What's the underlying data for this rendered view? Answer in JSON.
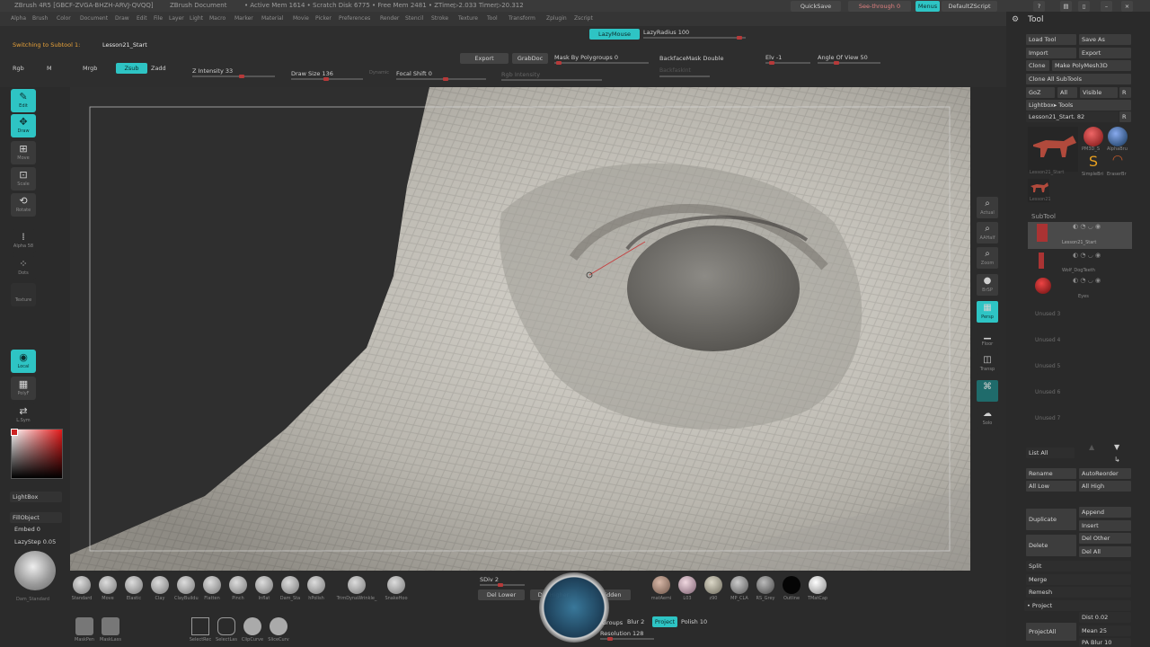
{
  "title": {
    "app": "ZBrush 4R5 [GBCF-ZVGA-BHZH-ARVJ-QVQQ]",
    "doc": "ZBrush Document",
    "stats": "• Active Mem 1614 • Scratch Disk 6775 • Free Mem 2481 • ZTime▷2.033 Timer▷20.312",
    "quicksave": "QuickSave",
    "seethrough": "See-through 0",
    "menus": "Menus",
    "script": "DefaultZScript"
  },
  "menu": [
    "Alpha",
    "Brush",
    "Color",
    "Document",
    "Draw",
    "Edit",
    "File",
    "Layer",
    "Light",
    "Macro",
    "Marker",
    "Material",
    "Movie",
    "Picker",
    "Preferences",
    "Render",
    "Stencil",
    "Stroke",
    "Texture",
    "Tool",
    "Transform",
    "Zplugin",
    "Zscript"
  ],
  "notice": {
    "prefix": "Switching to Subtool 1:",
    "name": "Lesson21_Start"
  },
  "top": {
    "lazymouse": "LazyMouse",
    "lazyradius": "LazyRadius 100",
    "export": "Export",
    "grabdoc": "GrabDoc",
    "mask": "Mask By Polygroups 0",
    "backface": "BackfaceMask Double",
    "elv": "Elv -1",
    "angle": "Angle Of View 50",
    "rgb": "Rgb",
    "m": "M",
    "mrgb": "Mrgb",
    "zsub": "Zsub",
    "zadd": "Zadd",
    "zint": "Z Intensity 33",
    "drawsize": "Draw Size 136",
    "dynamic": "Dynamic",
    "focal": "Focal Shift 0",
    "rgbint": "Rgb Intensity",
    "backmaskint": "BackfaskInt"
  },
  "left": {
    "edit": "Edit",
    "draw": "Draw",
    "move": "Move",
    "scale": "Scale",
    "rotate": "Rotate",
    "alpha": "Alpha 58",
    "dots": "Dots",
    "texture": "Texture",
    "local": "Local",
    "polyf": "PolyF",
    "lsym": "L.Sym",
    "lightbox": "LightBox",
    "fillobject": "FillObject",
    "embed": "Embed 0",
    "lazystep": "LazyStep 0.05",
    "brush": "Dam_Standard"
  },
  "right": {
    "actual": "Actual",
    "aahalf": "AAHalf",
    "zoom": "Zoom",
    "brsp": "BrSP",
    "persp": "Persp",
    "floor": "Floor",
    "transp": "Transp",
    "solo": "Solo"
  },
  "brushes": [
    "Standard",
    "Move",
    "Elastic",
    "Clay",
    "ClayBuildu",
    "Flatten",
    "Pinch",
    "Inflat",
    "Dam_Sta",
    "hPolish",
    "TrimDynaWrinkle_",
    "SnakeHoo"
  ],
  "materials": [
    "matAemi",
    "L03",
    "z90",
    "MP_CLA",
    "RS_Grey",
    "Outline",
    "TMatCap"
  ],
  "bottom": {
    "sdiv": "SDiv 2",
    "dellower": "Del Lower",
    "delhigher": "Del Higher",
    "hidden": "Hidden",
    "maskpen": "MaskPen",
    "masklass": "MaskLass",
    "selectrec": "SelectRec",
    "selectlas": "SelectLas",
    "clipcurve": "ClipCurve",
    "slicecurv": "SliceCurv",
    "groups": "Groups",
    "blur": "Blur 2",
    "project": "Project",
    "polish": "Polish 10",
    "resolution": "Resolution 128"
  },
  "panel": {
    "header": "Tool",
    "load": "Load Tool",
    "saveas": "Save As",
    "import": "Import",
    "export": "Export",
    "clone": "Clone",
    "makepoly": "Make PolyMesh3D",
    "cloneall": "Clone All SubTools",
    "goz": "GoZ",
    "all": "All",
    "visible": "Visible",
    "r": "R",
    "lightbox": "Lightbox▸ Tools",
    "current": "Lesson21_Start. 82",
    "subtool": "SubTool",
    "st1": "Lesson21_Start",
    "st2": "Wolf_DogTeeth",
    "st3": "Eyes",
    "unused": [
      "Unused 3",
      "Unused 4",
      "Unused 5",
      "Unused 6",
      "Unused 7"
    ],
    "listall": "List All",
    "rename": "Rename",
    "autoreorder": "AutoReorder",
    "alllow": "All Low",
    "allhigh": "All High",
    "duplicate": "Duplicate",
    "append": "Append",
    "insert": "Insert",
    "delete": "Delete",
    "delother": "Del Other",
    "delall": "Del All",
    "split": "Split",
    "merge": "Merge",
    "remesh": "Remesh",
    "project": "• Project",
    "projectall": "ProjectAll",
    "dist": "Dist 0.02",
    "mean": "Mean 25",
    "pablur": "PA Blur 10",
    "thumbs": [
      "PM3D_S",
      "AlphaBru",
      "SimpleBri",
      "EraserBr",
      "Lesson21_Start",
      "Lesson21"
    ]
  },
  "colors": {
    "accent": "#2ec4c4",
    "slider": "#b63a3a"
  }
}
